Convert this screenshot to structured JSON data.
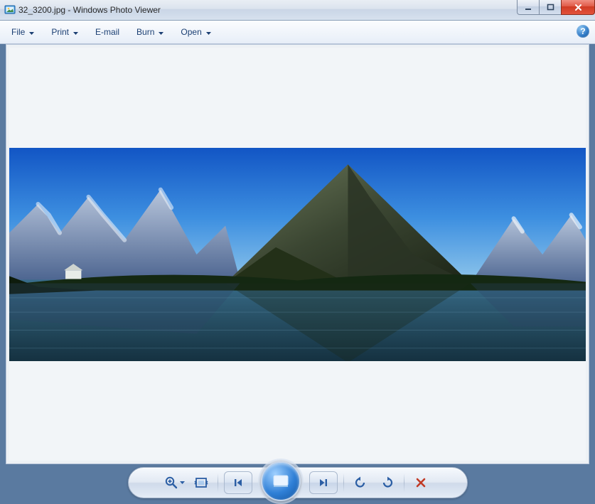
{
  "window": {
    "filename": "32_3200.jpg",
    "app_name": "Windows Photo Viewer",
    "title_separator": " - "
  },
  "menu": {
    "file": "File",
    "print": "Print",
    "email": "E-mail",
    "burn": "Burn",
    "open": "Open"
  },
  "controls": {
    "zoom": "zoom",
    "fit": "fit-to-window",
    "prev": "previous",
    "slideshow": "play-slideshow",
    "next": "next",
    "rotate_ccw": "rotate-counterclockwise",
    "rotate_cw": "rotate-clockwise",
    "delete": "delete"
  },
  "image": {
    "description": "Panoramic landscape photo of mountains and a lake under a clear blue sky"
  }
}
